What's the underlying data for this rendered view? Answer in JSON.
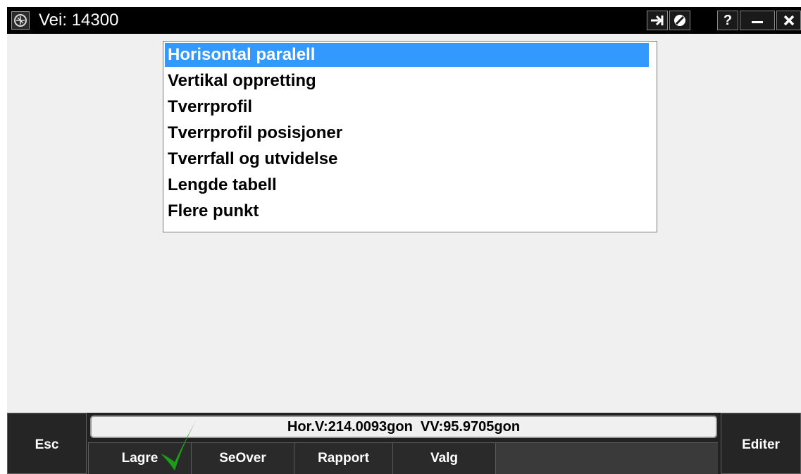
{
  "window": {
    "title": "Vei: 14300"
  },
  "titlebar_buttons": {
    "help_label": "?"
  },
  "menu": {
    "selected_index": 0,
    "items": [
      {
        "label": "Horisontal paralell"
      },
      {
        "label": "Vertikal oppretting"
      },
      {
        "label": "Tverrprofil"
      },
      {
        "label": "Tverrprofil posisjoner"
      },
      {
        "label": "Tverrfall og utvidelse"
      },
      {
        "label": "Lengde tabell"
      },
      {
        "label": "Flere punkt"
      }
    ]
  },
  "status": {
    "text": "Hor.V:214.0093gon  VV:95.9705gon"
  },
  "softkeys": {
    "esc": "Esc",
    "edit": "Editer",
    "items": [
      {
        "label": "Lagre"
      },
      {
        "label": "SeOver"
      },
      {
        "label": "Rapport"
      },
      {
        "label": "Valg"
      },
      {
        "label": ""
      }
    ]
  },
  "colors": {
    "selection": "#3399ff",
    "check": "#1a9e1a"
  },
  "icons": {
    "app": "app-logo-icon",
    "titlebar": [
      "arrow-right-icon",
      "disable-icon",
      "help-icon",
      "minimize-icon",
      "close-icon"
    ]
  }
}
